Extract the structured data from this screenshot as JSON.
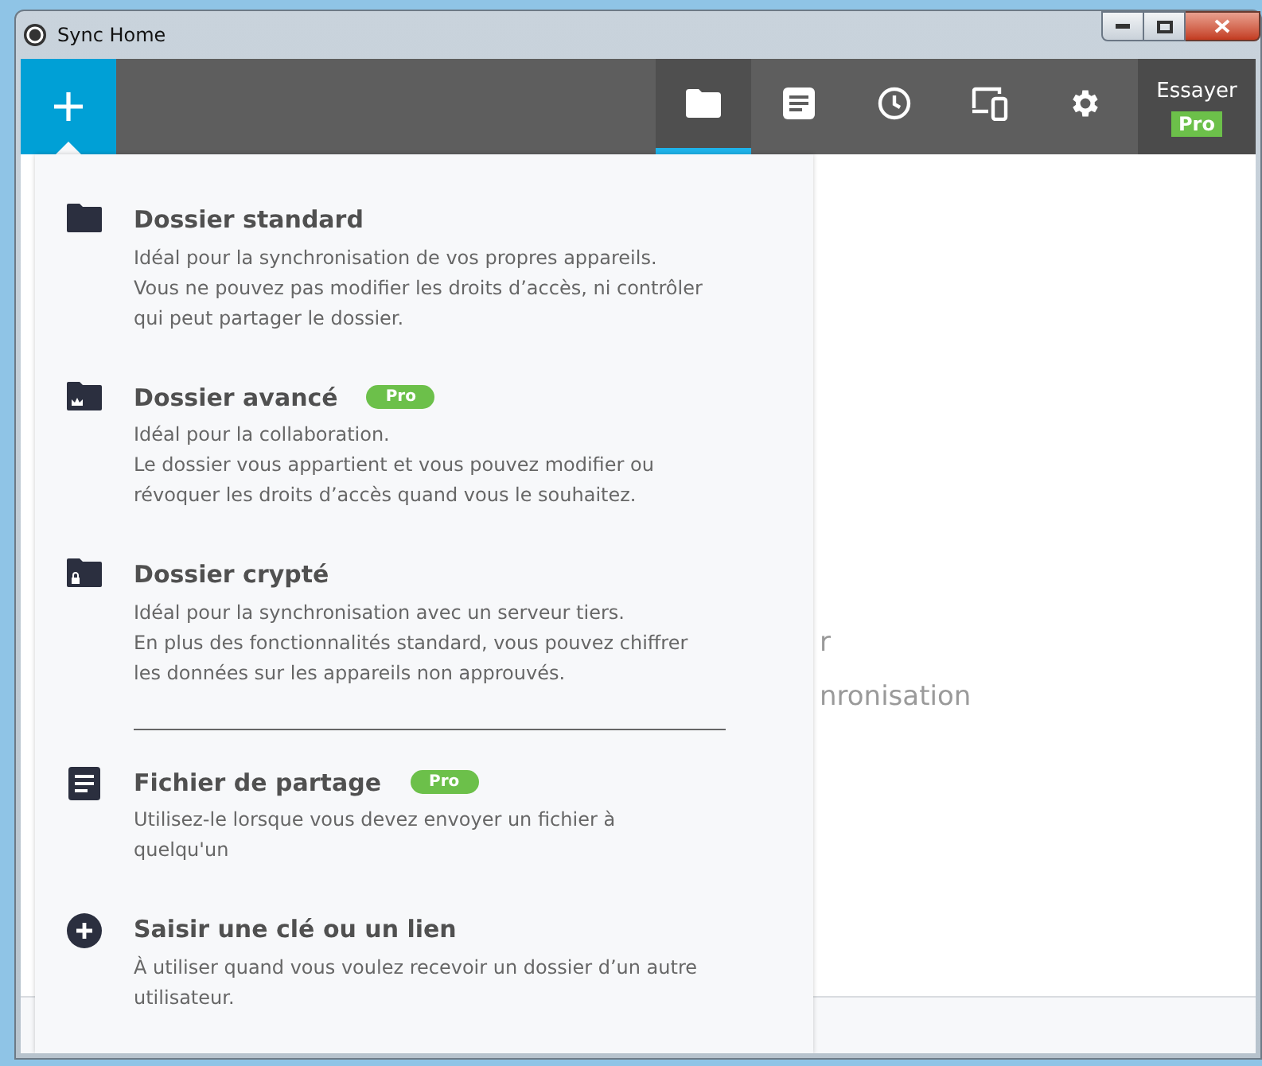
{
  "window": {
    "title": "Sync Home"
  },
  "toolbar": {
    "tabs": [
      {
        "kind": "folder",
        "selected": true
      },
      {
        "kind": "file",
        "selected": false
      },
      {
        "kind": "clock",
        "selected": false
      },
      {
        "kind": "devices",
        "selected": false
      },
      {
        "kind": "gear",
        "selected": false
      }
    ],
    "trial": {
      "label": "Essayer",
      "badge": "Pro"
    }
  },
  "background_text": [
    "r",
    "nronisation"
  ],
  "menu": {
    "groups": [
      [
        {
          "kind": "folder",
          "title": "Dossier standard",
          "description": "Idéal pour la synchronisation de vos propres appareils.\nVous ne pouvez pas modifier les droits d’accès, ni contrôler\nqui peut partager le dossier."
        },
        {
          "kind": "folder-crown",
          "title": "Dossier avancé",
          "badge": "Pro",
          "description": "Idéal pour la collaboration.\nLe dossier vous appartient et vous pouvez modifier ou\nrévoquer les droits d’accès quand vous le souhaitez."
        },
        {
          "kind": "folder-lock",
          "title": "Dossier crypté",
          "description": "Idéal pour la synchronisation avec un serveur tiers.\nEn plus des fonctionnalités standard, vous pouvez chiffrer\nles données sur les appareils non approuvés."
        }
      ],
      [
        {
          "kind": "file",
          "title": "Fichier de partage",
          "badge": "Pro",
          "description": "Utilisez-le lorsque vous devez envoyer un fichier à\nquelqu'un"
        },
        {
          "kind": "plus-circle",
          "title": "Saisir une clé ou un lien",
          "description": "À utiliser quand vous voulez recevoir un dossier d’un autre\nutilisateur."
        }
      ]
    ]
  }
}
